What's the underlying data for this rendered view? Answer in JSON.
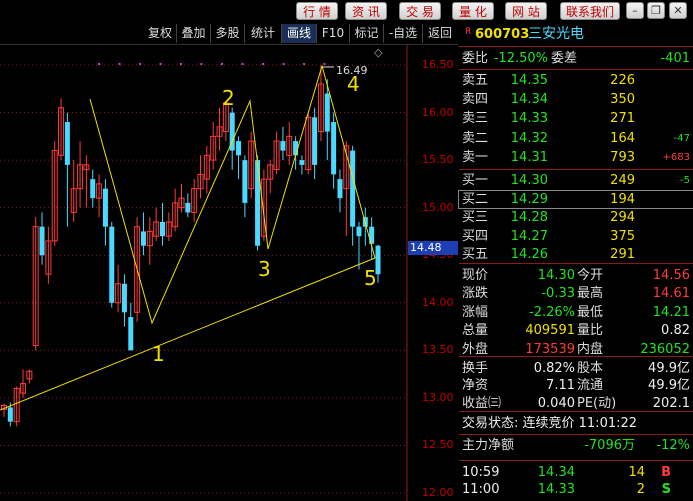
{
  "top_nav": [
    "行 情",
    "资 讯",
    "交 易",
    "量 化",
    "网 站",
    "联系我们"
  ],
  "toolbar": [
    "复权",
    "叠加",
    "多股",
    "统计",
    "画线",
    "F10",
    "标记",
    "-自选",
    "返回"
  ],
  "stock": {
    "flag": "R",
    "code": "600703",
    "name": "三安光电"
  },
  "ratio": {
    "label": "委比",
    "value": "-12.50%",
    "label2": "委差",
    "value2": "-401"
  },
  "sell": [
    {
      "label": "卖五",
      "price": "14.35",
      "vol": "226",
      "chg": ""
    },
    {
      "label": "卖四",
      "price": "14.34",
      "vol": "350",
      "chg": ""
    },
    {
      "label": "卖三",
      "price": "14.33",
      "vol": "271",
      "chg": ""
    },
    {
      "label": "卖二",
      "price": "14.32",
      "vol": "164",
      "chg": "-47"
    },
    {
      "label": "卖一",
      "price": "14.31",
      "vol": "793",
      "chg": "+683"
    }
  ],
  "buy": [
    {
      "label": "买一",
      "price": "14.30",
      "vol": "249",
      "chg": "-5"
    },
    {
      "label": "买二",
      "price": "14.29",
      "vol": "194",
      "chg": ""
    },
    {
      "label": "买三",
      "price": "14.28",
      "vol": "294",
      "chg": ""
    },
    {
      "label": "买四",
      "price": "14.27",
      "vol": "375",
      "chg": ""
    },
    {
      "label": "买五",
      "price": "14.26",
      "vol": "291",
      "chg": ""
    }
  ],
  "stats": [
    {
      "l1": "现价",
      "v1": "14.30",
      "l2": "今开",
      "v2": "14.56"
    },
    {
      "l1": "涨跌",
      "v1": "-0.33",
      "l2": "最高",
      "v2": "14.61"
    },
    {
      "l1": "涨幅",
      "v1": "-2.26%",
      "l2": "最低",
      "v2": "14.21"
    },
    {
      "l1": "总量",
      "v1": "409591",
      "l2": "量比",
      "v2": "0.82"
    },
    {
      "l1": "外盘",
      "v1": "173539",
      "l2": "内盘",
      "v2": "236052"
    }
  ],
  "stats2": [
    {
      "l1": "换手",
      "v1": "0.82%",
      "l2": "股本",
      "v2": "49.9亿"
    },
    {
      "l1": "净资",
      "v1": "7.11",
      "l2": "流通",
      "v2": "49.9亿"
    },
    {
      "l1": "收益㈢",
      "v1": "0.040",
      "l2": "PE(动)",
      "v2": "202.1"
    }
  ],
  "trade_status": "交易状态: 连续竞价 11:01:22",
  "main_flow": {
    "label": "主力净额",
    "value": "-7096万",
    "pct": "-12%"
  },
  "ticks": [
    {
      "time": "10:59",
      "price": "14.34",
      "vol": "14",
      "side": "B"
    },
    {
      "time": "11:00",
      "price": "14.33",
      "vol": "2",
      "side": "S"
    }
  ],
  "colors": {
    "up": "#ff3b3b",
    "down": "#4ad9ff",
    "line": "#f0e000",
    "grid": "#8b1a1a"
  },
  "chart_data": {
    "type": "candlestick",
    "yaxis_ticks": [
      "16.50",
      "16.00",
      "15.50",
      "15.00",
      "14.50",
      "14.00",
      "13.50",
      "13.00",
      "12.50",
      "12.00"
    ],
    "current_price_label": "14.48",
    "high_label": "16.49",
    "wave_labels": [
      "1",
      "2",
      "3",
      "4",
      "5"
    ],
    "candles": [
      [
        12.88,
        12.92,
        12.8,
        12.94
      ],
      [
        12.9,
        12.75,
        12.7,
        12.95
      ],
      [
        12.75,
        13.1,
        12.7,
        13.12
      ],
      [
        13.05,
        13.15,
        13.0,
        13.3
      ],
      [
        13.2,
        13.28,
        13.15,
        13.3
      ],
      [
        13.55,
        14.8,
        13.5,
        14.9
      ],
      [
        14.8,
        14.5,
        14.4,
        14.95
      ],
      [
        14.3,
        14.65,
        14.2,
        14.8
      ],
      [
        14.65,
        15.6,
        14.6,
        15.7
      ],
      [
        15.55,
        16.05,
        15.5,
        16.15
      ],
      [
        15.9,
        15.45,
        14.8,
        16.0
      ],
      [
        14.95,
        15.2,
        14.85,
        15.5
      ],
      [
        15.2,
        15.45,
        15.0,
        15.7
      ],
      [
        15.4,
        15.45,
        15.0,
        15.55
      ],
      [
        15.3,
        15.1,
        15.0,
        15.4
      ],
      [
        15.1,
        15.25,
        14.9,
        15.35
      ],
      [
        15.2,
        14.8,
        14.6,
        15.3
      ],
      [
        14.8,
        14.0,
        13.95,
        14.85
      ],
      [
        14.0,
        14.2,
        13.9,
        14.4
      ],
      [
        14.2,
        13.9,
        13.75,
        14.3
      ],
      [
        13.85,
        13.5,
        13.5,
        14.0
      ],
      [
        13.9,
        14.8,
        13.8,
        14.9
      ],
      [
        14.75,
        14.6,
        14.5,
        14.95
      ],
      [
        14.6,
        14.75,
        14.4,
        14.9
      ],
      [
        14.7,
        14.85,
        14.65,
        15.0
      ],
      [
        14.85,
        14.7,
        14.6,
        15.05
      ],
      [
        14.7,
        14.85,
        14.65,
        14.95
      ],
      [
        14.8,
        15.05,
        14.75,
        15.2
      ],
      [
        15.0,
        15.1,
        14.95,
        15.25
      ],
      [
        15.05,
        14.95,
        14.9,
        15.15
      ],
      [
        14.95,
        15.2,
        14.85,
        15.3
      ],
      [
        15.2,
        15.35,
        15.1,
        15.55
      ],
      [
        15.3,
        15.55,
        15.15,
        15.65
      ],
      [
        15.5,
        15.75,
        15.4,
        15.9
      ],
      [
        15.75,
        15.85,
        15.6,
        16.05
      ],
      [
        15.8,
        16.1,
        15.7,
        16.1
      ],
      [
        16.0,
        15.6,
        15.4,
        16.05
      ],
      [
        15.7,
        15.55,
        15.3,
        15.75
      ],
      [
        15.5,
        15.05,
        14.9,
        15.55
      ],
      [
        15.2,
        15.7,
        15.1,
        15.8
      ],
      [
        15.5,
        14.6,
        14.55,
        15.55
      ],
      [
        14.7,
        15.3,
        14.65,
        15.4
      ],
      [
        15.3,
        15.45,
        15.15,
        15.5
      ],
      [
        15.4,
        15.7,
        15.35,
        15.8
      ],
      [
        15.7,
        15.6,
        15.5,
        15.85
      ],
      [
        15.55,
        15.75,
        15.45,
        15.9
      ],
      [
        15.7,
        15.55,
        15.4,
        15.75
      ],
      [
        15.5,
        15.45,
        15.35,
        15.55
      ],
      [
        15.4,
        15.95,
        15.35,
        16.0
      ],
      [
        15.95,
        15.45,
        15.3,
        16.05
      ],
      [
        15.8,
        16.3,
        15.7,
        16.49
      ],
      [
        16.2,
        15.8,
        15.5,
        16.35
      ],
      [
        15.9,
        15.35,
        15.2,
        16.0
      ],
      [
        15.3,
        15.1,
        14.95,
        15.4
      ],
      [
        15.2,
        15.65,
        14.7,
        15.7
      ],
      [
        15.6,
        14.8,
        14.6,
        15.65
      ],
      [
        14.8,
        14.7,
        14.35,
        14.85
      ],
      [
        14.9,
        14.8,
        14.6,
        15.0
      ],
      [
        14.8,
        14.62,
        14.45,
        14.9
      ],
      [
        14.6,
        14.3,
        14.21,
        14.61
      ]
    ]
  }
}
